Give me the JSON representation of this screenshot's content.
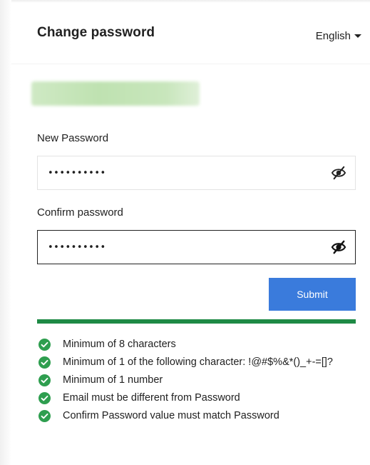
{
  "header": {
    "title": "Change password",
    "language": "English"
  },
  "form": {
    "new_password": {
      "label": "New Password",
      "value": "••••••••••",
      "icon": "eye-slash-icon"
    },
    "confirm_password": {
      "label": "Confirm password",
      "value": "••••••••••",
      "icon": "eye-slash-icon"
    },
    "submit_label": "Submit"
  },
  "strength": {
    "level_percent": 100,
    "color": "#1e8a45"
  },
  "rules": [
    {
      "text": "Minimum of 8 characters",
      "met": true
    },
    {
      "text": "Minimum of 1 of the following character: !@#$%&*()_+-=[]?",
      "met": true
    },
    {
      "text": "Minimum of 1 number",
      "met": true
    },
    {
      "text": "Email must be different from Password",
      "met": true
    },
    {
      "text": "Confirm Password value must match Password",
      "met": true
    }
  ],
  "colors": {
    "accent": "#3a7bdc",
    "success": "#1e8a45",
    "check": "#2e9e4f"
  }
}
